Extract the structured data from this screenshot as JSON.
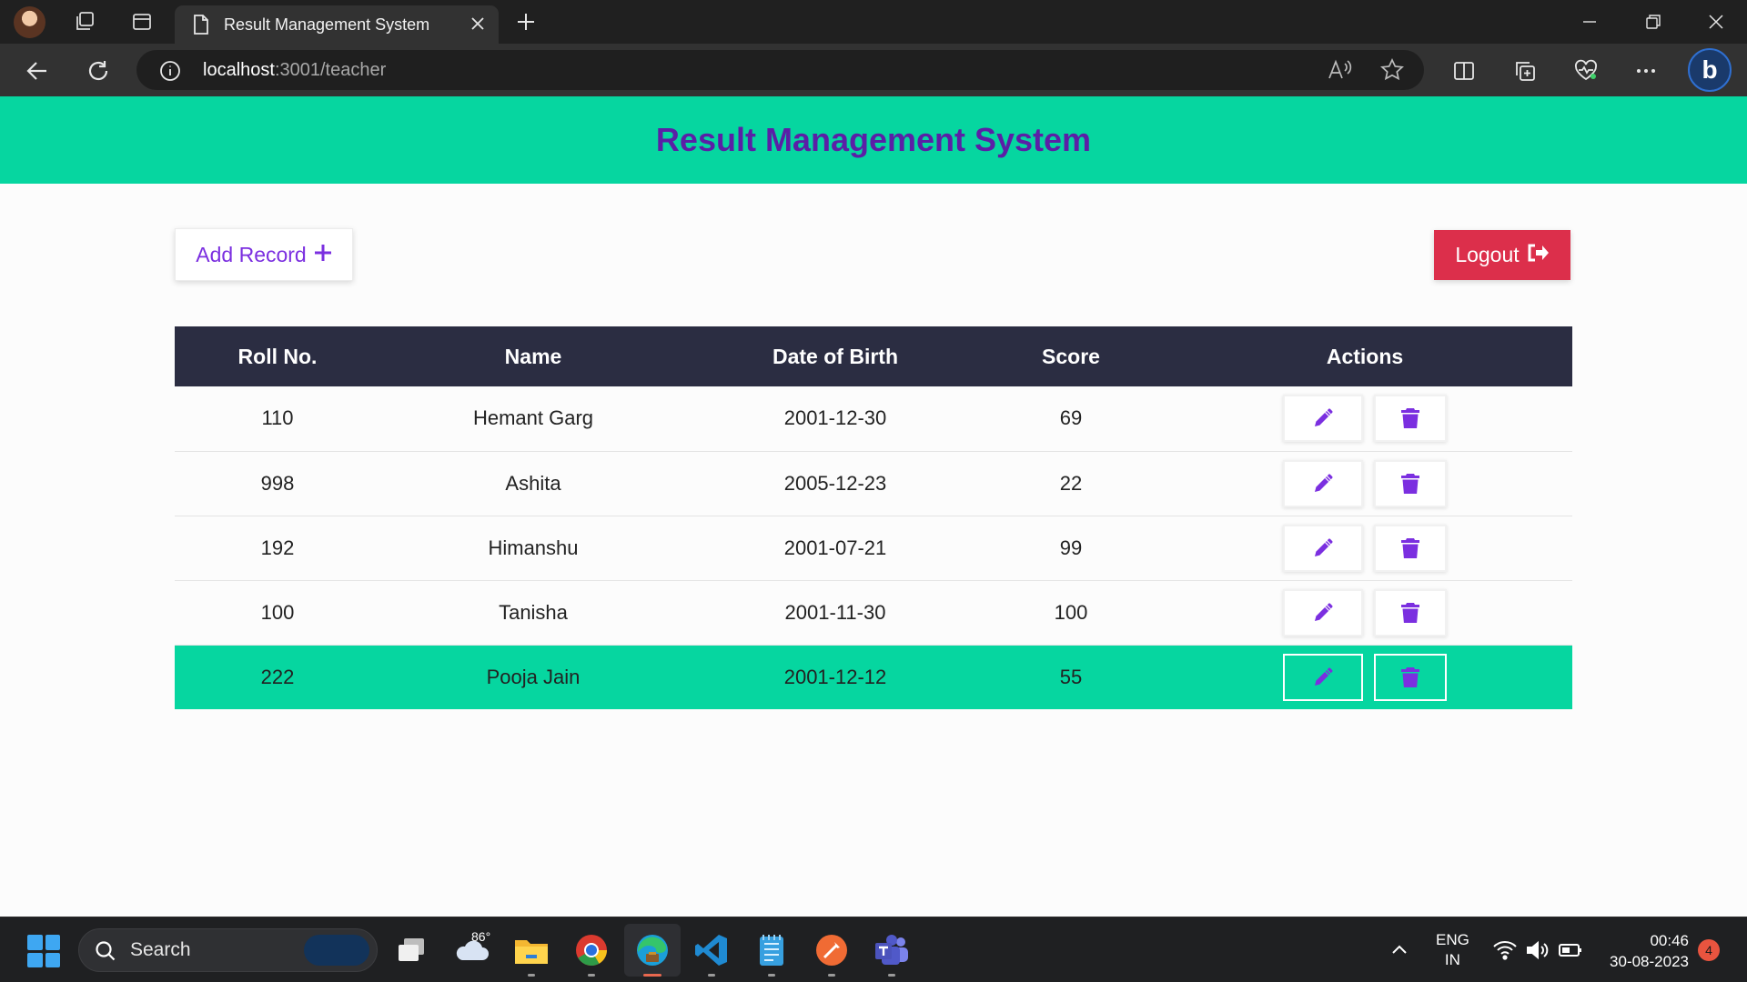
{
  "browser": {
    "tab_title": "Result Management System",
    "url_host": "localhost",
    "url_path": ":3001/teacher",
    "bing_letter": "b"
  },
  "app": {
    "title": "Result Management System",
    "add_record_label": "Add Record",
    "logout_label": "Logout",
    "accent_color": "#06d6a0",
    "title_color": "#5b1fa6",
    "logout_color": "#dc2f4b",
    "icon_color": "#7b2fe0"
  },
  "table": {
    "headers": [
      "Roll No.",
      "Name",
      "Date of Birth",
      "Score",
      "Actions"
    ],
    "rows": [
      {
        "roll": "110",
        "name": "Hemant Garg",
        "dob": "2001-12-30",
        "score": "69"
      },
      {
        "roll": "998",
        "name": "Ashita",
        "dob": "2005-12-23",
        "score": "22"
      },
      {
        "roll": "192",
        "name": "Himanshu",
        "dob": "2001-07-21",
        "score": "99"
      },
      {
        "roll": "100",
        "name": "Tanisha",
        "dob": "2001-11-30",
        "score": "100"
      },
      {
        "roll": "222",
        "name": "Pooja Jain",
        "dob": "2001-12-12",
        "score": "55"
      }
    ]
  },
  "taskbar": {
    "search_label": "Search",
    "weather_temp": "86°",
    "lang_1": "ENG",
    "lang_2": "IN",
    "time": "00:46",
    "date": "30-08-2023",
    "notifications": "4"
  }
}
